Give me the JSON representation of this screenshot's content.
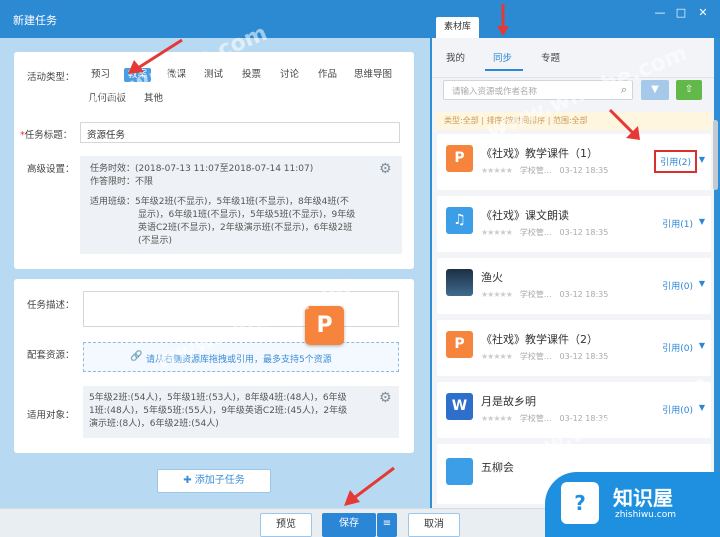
{
  "window": {
    "title": "新建任务",
    "min": "—",
    "max": "□",
    "close": "✕"
  },
  "activity": {
    "label": "活动类型：",
    "types": [
      "预习",
      "教案",
      "微课",
      "测试",
      "投票",
      "讨论",
      "作品",
      "思维导图",
      "几何画板",
      "其他"
    ]
  },
  "task_title": {
    "label": "任务标题：",
    "required_mark": "*",
    "value": "资源任务"
  },
  "advanced": {
    "label": "高级设置：",
    "line1": "任务时效：(2018-07-13 11:07至2018-07-14 11:07)",
    "line2": "作答限时：不限",
    "line3": "适用班级：5年级2班(不显示)，5年级1班(不显示)，8年级4班(不",
    "line4": "显示)，6年级1班(不显示)，5年级5班(不显示)，9年级",
    "line5": "英语C2班(不显示)，2年级演示班(不显示)，6年级2班",
    "line6": "(不显示)"
  },
  "description": {
    "label": "任务描述：",
    "value": ""
  },
  "resource": {
    "label": "配套资源：",
    "hint": "请从右侧资源库拖拽或引用，最多支持5个资源"
  },
  "target": {
    "label": "适用对象：",
    "line1": "5年级2班:(54人)，5年级1班:(53人)，8年级4班:(48人)，6年级",
    "line2": "1班:(48人)，5年级5班:(55人)，9年级英语C2班:(45人)，2年级",
    "line3": "演示班:(8人)，6年级2班:(54人)"
  },
  "add_subtask": "✚ 添加子任务",
  "footer": {
    "preview": "预览",
    "save": "保存",
    "save_menu": "≡",
    "cancel": "取消"
  },
  "right": {
    "tab": "素材库",
    "subtabs": [
      "我的",
      "同步",
      "专题"
    ],
    "search_placeholder": "请输入资源或作者名称",
    "filter_text": "类型:全部 | 排序:按时间排序 | 范围:全部",
    "items": [
      {
        "name": "《社戏》教学课件（1）",
        "icon": "P",
        "color": "#f7843d",
        "stars": "★★★★★",
        "author": "学校管...",
        "date": "03-12 18:35",
        "cite": "引用(2)"
      },
      {
        "name": "《社戏》课文朗读",
        "icon": "♫",
        "color": "#3b9ee6",
        "stars": "★★★★★",
        "author": "学校管...",
        "date": "03-12 18:35",
        "cite": "引用(1)"
      },
      {
        "name": "渔火",
        "icon": "",
        "color": "#2b4a6b",
        "stars": "★★★★★",
        "author": "学校管...",
        "date": "03-12 18:35",
        "cite": "引用(0)"
      },
      {
        "name": "《社戏》教学课件（2）",
        "icon": "P",
        "color": "#f7843d",
        "stars": "★★★★★",
        "author": "学校管...",
        "date": "03-12 18:35",
        "cite": "引用(0)"
      },
      {
        "name": "月是故乡明",
        "icon": "W",
        "color": "#2f6fcc",
        "stars": "★★★★★",
        "author": "学校管...",
        "date": "03-12 18:35",
        "cite": "引用(0)"
      },
      {
        "name": "五柳会",
        "icon": "",
        "color": "#3b9ee6",
        "stars": "",
        "author": "",
        "date": "",
        "cite": ""
      }
    ]
  },
  "overlay": {
    "watermark": "www.wmzhe.com",
    "big_p": "P",
    "logo_cn": "知识屋",
    "logo_url": "zhishiwu.com"
  }
}
